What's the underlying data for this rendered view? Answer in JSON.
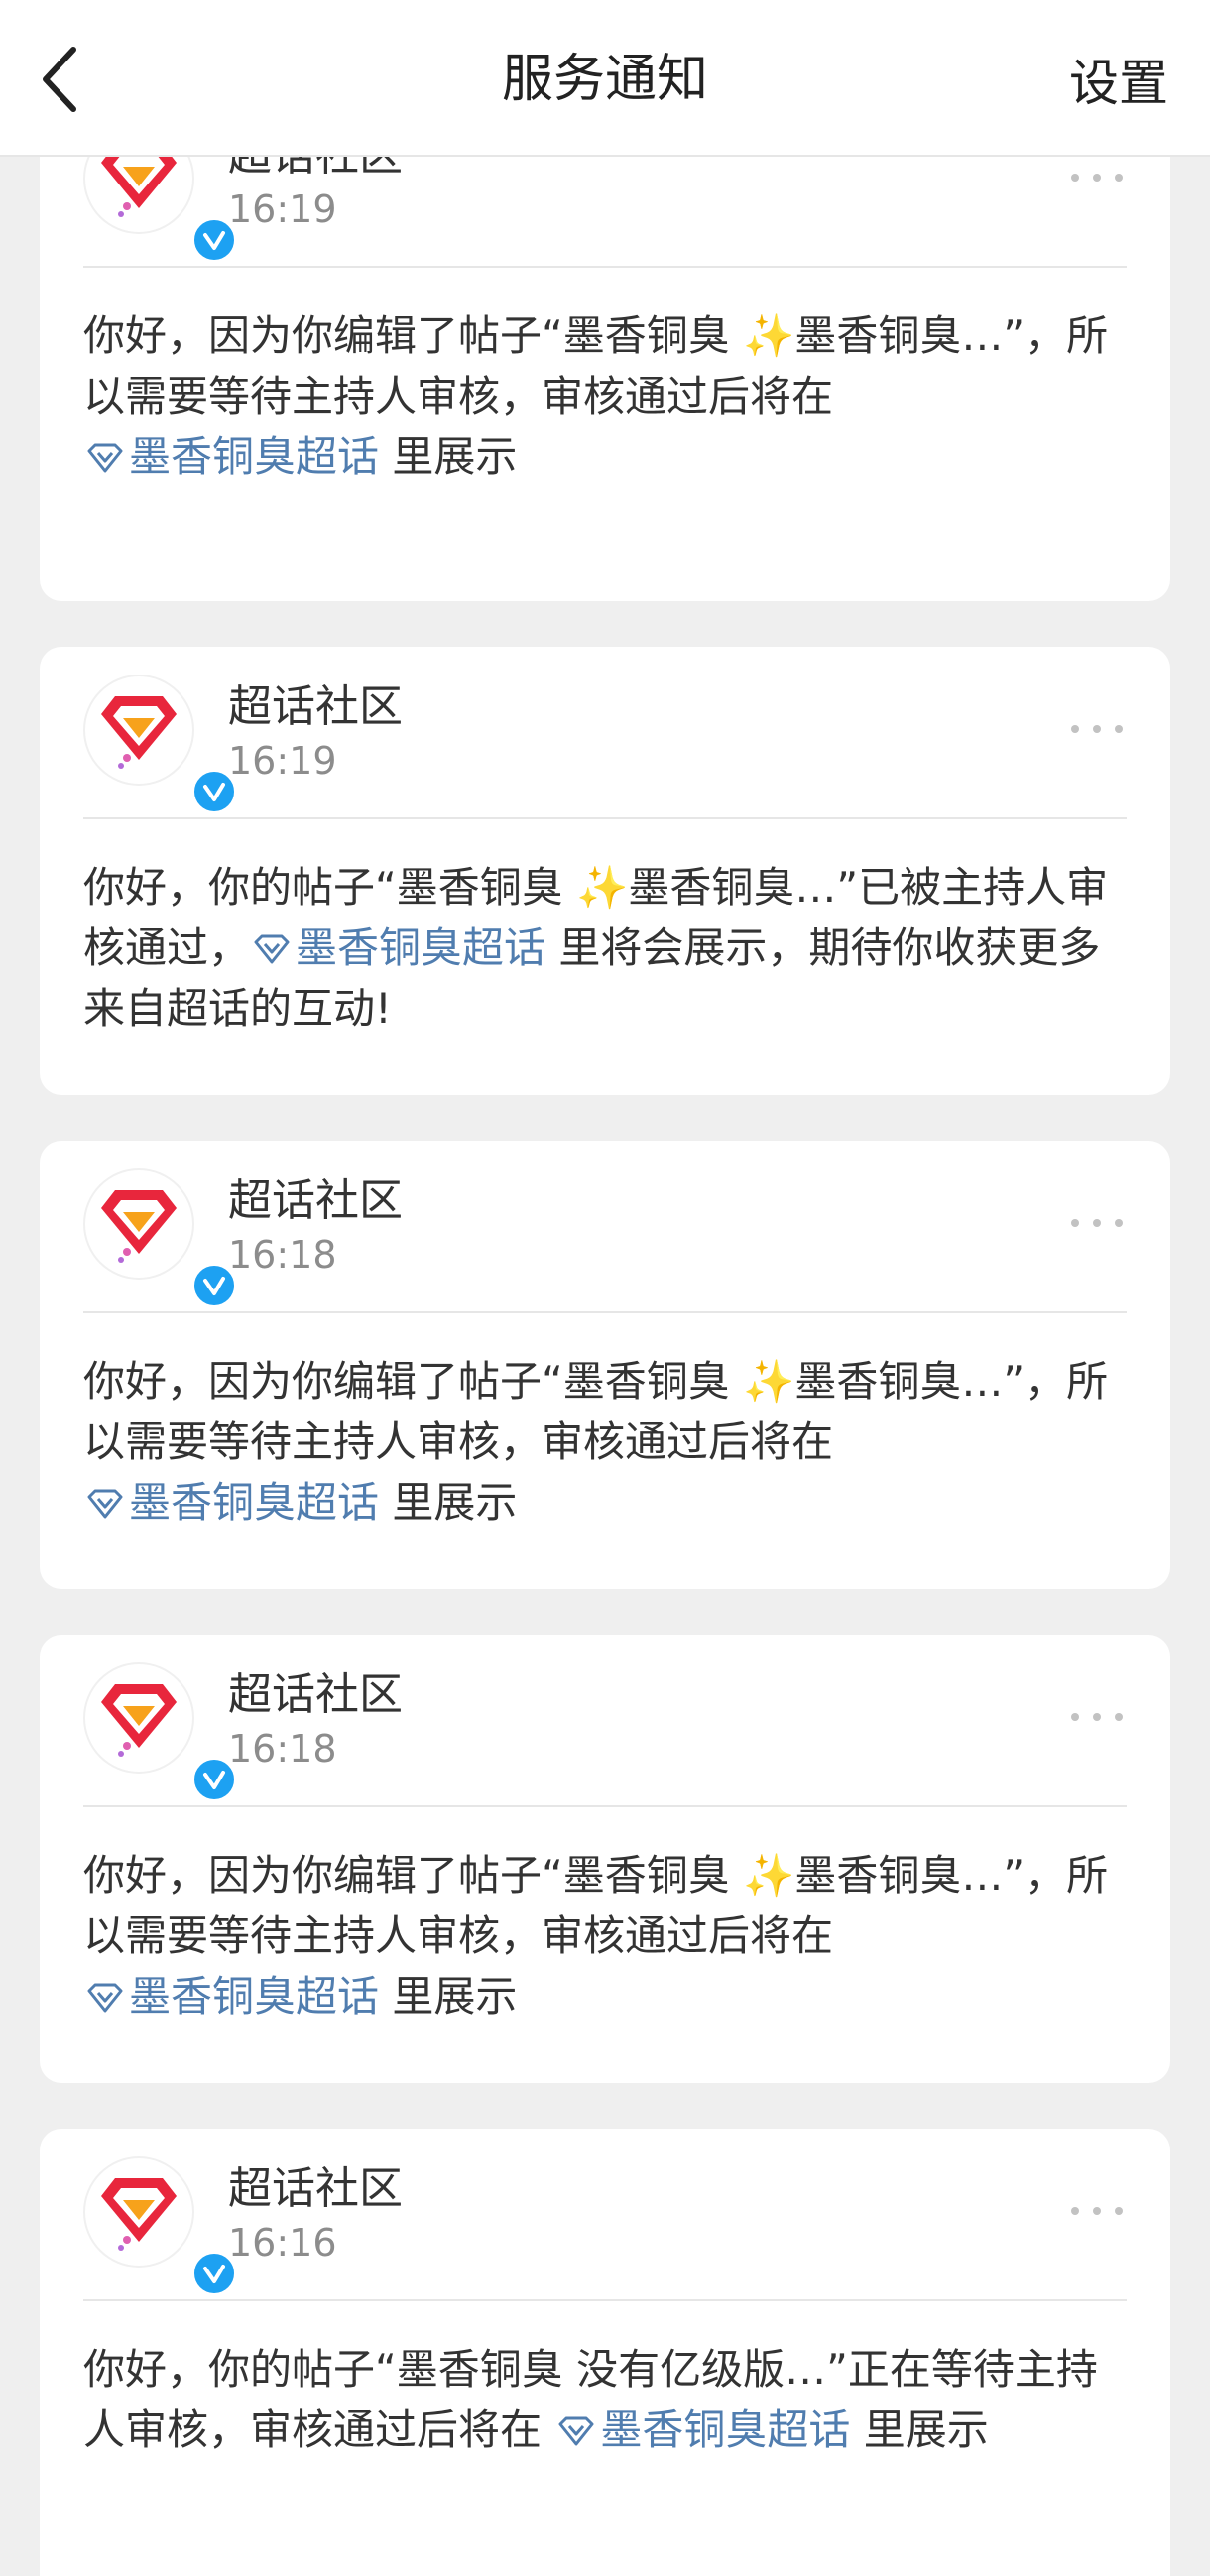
{
  "header": {
    "title": "服务通知",
    "settings_label": "设置"
  },
  "notifications": [
    {
      "sender": "超话社区",
      "time": "16:19",
      "parts": [
        "你好，因为你编辑了帖子“墨香铜臭 ",
        "✨",
        "墨香铜臭…”，所以需要等待主持人审核，审核通过后将在 ",
        "墨香铜臭超话",
        " 里展示"
      ]
    },
    {
      "sender": "超话社区",
      "time": "16:19",
      "parts": [
        "你好，你的帖子“墨香铜臭 ",
        "✨",
        "墨香铜臭…”已被主持人审核通过，",
        "墨香铜臭超话",
        " 里将会展示，期待你收获更多来自超话的互动!"
      ]
    },
    {
      "sender": "超话社区",
      "time": "16:18",
      "parts": [
        "你好，因为你编辑了帖子“墨香铜臭 ",
        "✨",
        "墨香铜臭…”，所以需要等待主持人审核，审核通过后将在 ",
        "墨香铜臭超话",
        " 里展示"
      ]
    },
    {
      "sender": "超话社区",
      "time": "16:18",
      "parts": [
        "你好，因为你编辑了帖子“墨香铜臭 ",
        "✨",
        "墨香铜臭…”，所以需要等待主持人审核，审核通过后将在 ",
        "墨香铜臭超话",
        " 里展示"
      ]
    },
    {
      "sender": "超话社区",
      "time": "16:16",
      "parts": [
        "你好，你的帖子“墨香铜臭 没有亿级版…”正在等待主持人审核，审核通过后将在 ",
        "",
        "",
        "墨香铜臭超话",
        " 里展示"
      ]
    }
  ],
  "colors": {
    "link": "#507daf",
    "background": "#efefef",
    "verified": "#1da1f2"
  },
  "icons": {
    "back": "chevron-left-icon",
    "more": "more-dots-icon",
    "topic": "diamond-icon",
    "verified": "verified-check-icon"
  }
}
